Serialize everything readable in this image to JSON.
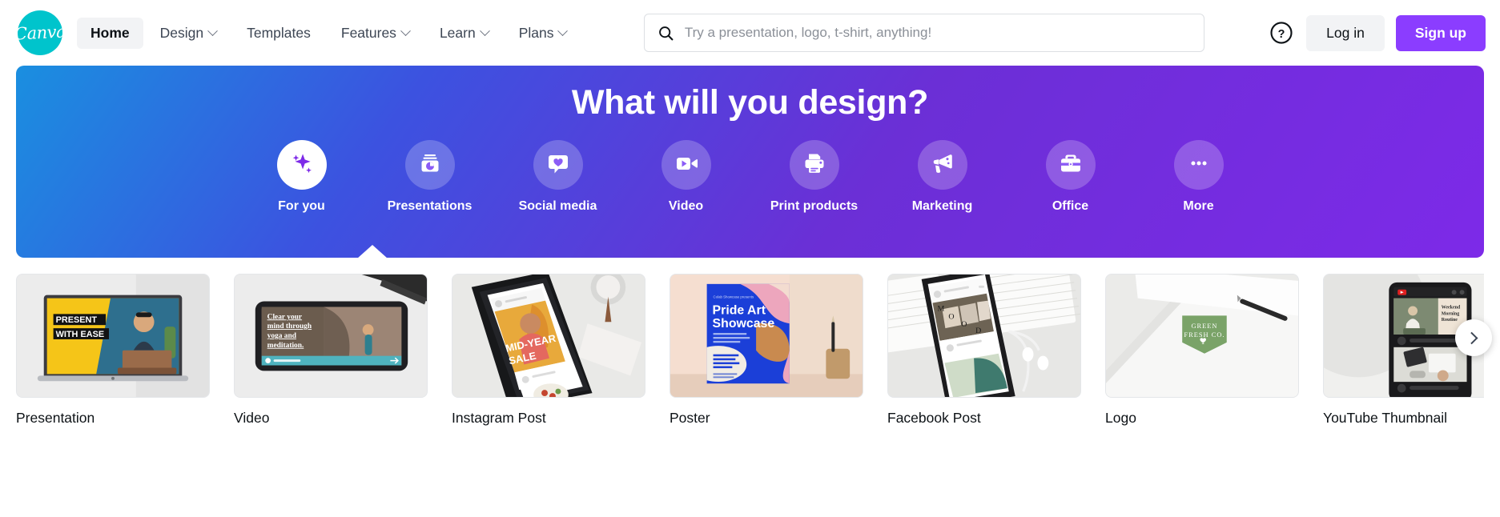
{
  "brand": {
    "name": "Canva",
    "logo_color": "#00c4cc"
  },
  "header": {
    "nav": [
      {
        "label": "Home",
        "icon": "",
        "has_caret": false,
        "active": true
      },
      {
        "label": "Design",
        "icon": "chevron-down-icon",
        "has_caret": true,
        "active": false
      },
      {
        "label": "Templates",
        "icon": "",
        "has_caret": false,
        "active": false
      },
      {
        "label": "Features",
        "icon": "chevron-down-icon",
        "has_caret": true,
        "active": false
      },
      {
        "label": "Learn",
        "icon": "chevron-down-icon",
        "has_caret": true,
        "active": false
      },
      {
        "label": "Plans",
        "icon": "chevron-down-icon",
        "has_caret": true,
        "active": false
      }
    ],
    "search": {
      "value": "",
      "placeholder": "Try a presentation, logo, t-shirt, anything!",
      "icon": "search-icon"
    },
    "help_icon": "help-circle-icon",
    "login_label": "Log in",
    "signup_label": "Sign up",
    "signup_color": "#8b3dff"
  },
  "hero": {
    "title": "What will you design?",
    "gradient_from": "#1a8fe0",
    "gradient_to": "#7d2ae8",
    "categories": [
      {
        "label": "For you",
        "icon": "sparkles-icon",
        "selected": true
      },
      {
        "label": "Presentations",
        "icon": "presentation-chart-icon",
        "selected": false
      },
      {
        "label": "Social media",
        "icon": "heart-speech-bubble-icon",
        "selected": false
      },
      {
        "label": "Video",
        "icon": "video-camera-icon",
        "selected": false
      },
      {
        "label": "Print products",
        "icon": "printer-icon",
        "selected": false
      },
      {
        "label": "Marketing",
        "icon": "megaphone-icon",
        "selected": false
      },
      {
        "label": "Office",
        "icon": "briefcase-icon",
        "selected": false
      },
      {
        "label": "More",
        "icon": "ellipsis-icon",
        "selected": false
      }
    ]
  },
  "cards": {
    "next_icon": "chevron-right-icon",
    "items": [
      {
        "label": "Presentation",
        "thumb": "laptop-present-with-ease",
        "thumb_text": "PRESENT WITH EASE"
      },
      {
        "label": "Video",
        "thumb": "tablet-yoga-meditation",
        "thumb_text": "Clear your mind through yoga and meditation."
      },
      {
        "label": "Instagram Post",
        "thumb": "phone-mid-year-sale",
        "thumb_text": "MID-YEAR SALE"
      },
      {
        "label": "Poster",
        "thumb": "poster-pride-art-showcase",
        "thumb_text": "Pride Art Showcase"
      },
      {
        "label": "Facebook Post",
        "thumb": "phone-mood-grid",
        "thumb_text": "M O O D"
      },
      {
        "label": "Logo",
        "thumb": "green-fresh-co-logo",
        "thumb_text": "GREEN FRESH CO."
      },
      {
        "label": "YouTube Thumbnail",
        "thumb": "phone-weekend-morning-routine",
        "thumb_text": "Weekend Morning Routine"
      }
    ]
  }
}
